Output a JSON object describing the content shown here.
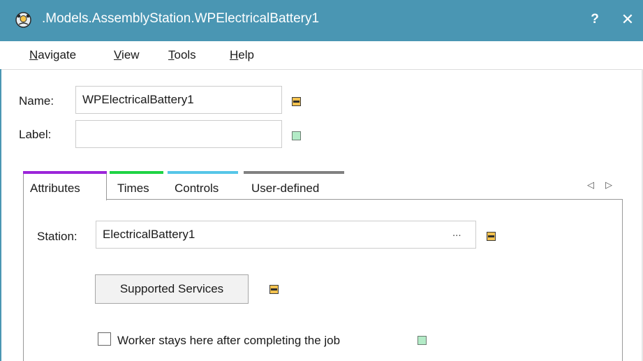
{
  "window": {
    "title": ".Models.AssemblyStation.WPElectricalBattery1",
    "help_label": "?",
    "close_label": "✕"
  },
  "menu": {
    "items": [
      {
        "label": "Navigate",
        "underline": "N",
        "rest": "avigate"
      },
      {
        "label": "View",
        "underline": "V",
        "rest": "iew"
      },
      {
        "label": "Tools",
        "underline": "T",
        "rest": "ools"
      },
      {
        "label": "Help",
        "underline": "H",
        "rest": "elp"
      }
    ]
  },
  "form": {
    "name_label": "Name:",
    "name_value": "WPElectricalBattery1",
    "label_label": "Label:",
    "label_value": ""
  },
  "tabs": [
    {
      "label": "Attributes",
      "accent": "#9b25d9",
      "active": true
    },
    {
      "label": "Times",
      "accent": "#1fd344",
      "active": false
    },
    {
      "label": "Controls",
      "accent": "#56c6e8",
      "active": false
    },
    {
      "label": "User-defined",
      "accent": "#808080",
      "active": false
    }
  ],
  "tab_scroll": {
    "left": "◁",
    "right": "▷"
  },
  "attributes": {
    "station_label": "Station:",
    "station_value": "ElectricalBattery1",
    "station_browse": "...",
    "supported_services_label": "Supported Services",
    "worker_stays_label": "Worker stays here after completing the job",
    "worker_stays_checked": false
  },
  "colors": {
    "titlebar": "#4a96b3",
    "marker_inherited": "#f3c24f",
    "marker_local": "#b3ebc7"
  },
  "icons": {
    "app": "app-icon",
    "inherit_marker": "inheritance-marker-icon"
  }
}
